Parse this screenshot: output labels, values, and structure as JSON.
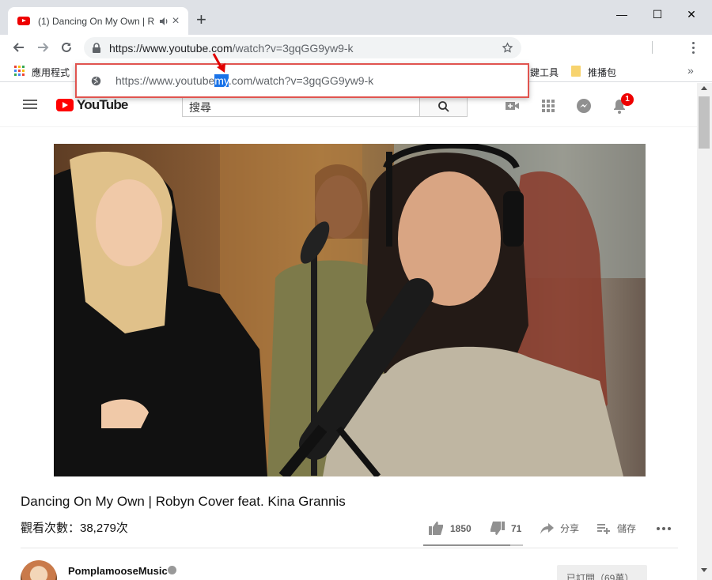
{
  "browser": {
    "tab_title": "(1) Dancing On My Own | R",
    "new_tab_glyph": "+",
    "close_glyph": "×",
    "window_controls": [
      "—",
      "☐",
      "✕"
    ],
    "address_url": "https://www.youtube.com/watch?v=3gqGG9yw9-k",
    "address_host": "https://www.youtube.com",
    "address_path": "/watch?v=3gqGG9yw9-k",
    "bookmarks": {
      "apps_label": "應用程式",
      "partial_label": "鍵工具",
      "folder_label": "推播包",
      "more_glyph": "»"
    },
    "suggestion": {
      "prefix": "https://www.youtube",
      "selected": "my",
      "suffix": ".com/watch?v=3gqGG9yw9-k"
    },
    "colors": {
      "highlight_border": "#e0544f",
      "selection": "#1a73e8",
      "arrow": "#e00000"
    }
  },
  "youtube": {
    "logo_text": "YouTube",
    "search_placeholder": "搜尋",
    "notification_count": "1",
    "video_title": "Dancing On My Own | Robyn Cover feat. Kina Grannis",
    "views": "觀看次數：38,279次",
    "likes": "1850",
    "dislikes": "71",
    "share_label": "分享",
    "save_label": "儲存",
    "like_ratio": 0.87,
    "channel_name": "PomplamooseMusic",
    "subscribe_label": "已訂閱（69萬）",
    "icons": [
      "menu-icon",
      "search-icon",
      "create-video-icon",
      "apps-icon",
      "messages-icon",
      "bell-icon",
      "like-icon",
      "dislike-icon",
      "share-icon",
      "playlist-add-icon",
      "more-icon",
      "verified-icon"
    ]
  }
}
